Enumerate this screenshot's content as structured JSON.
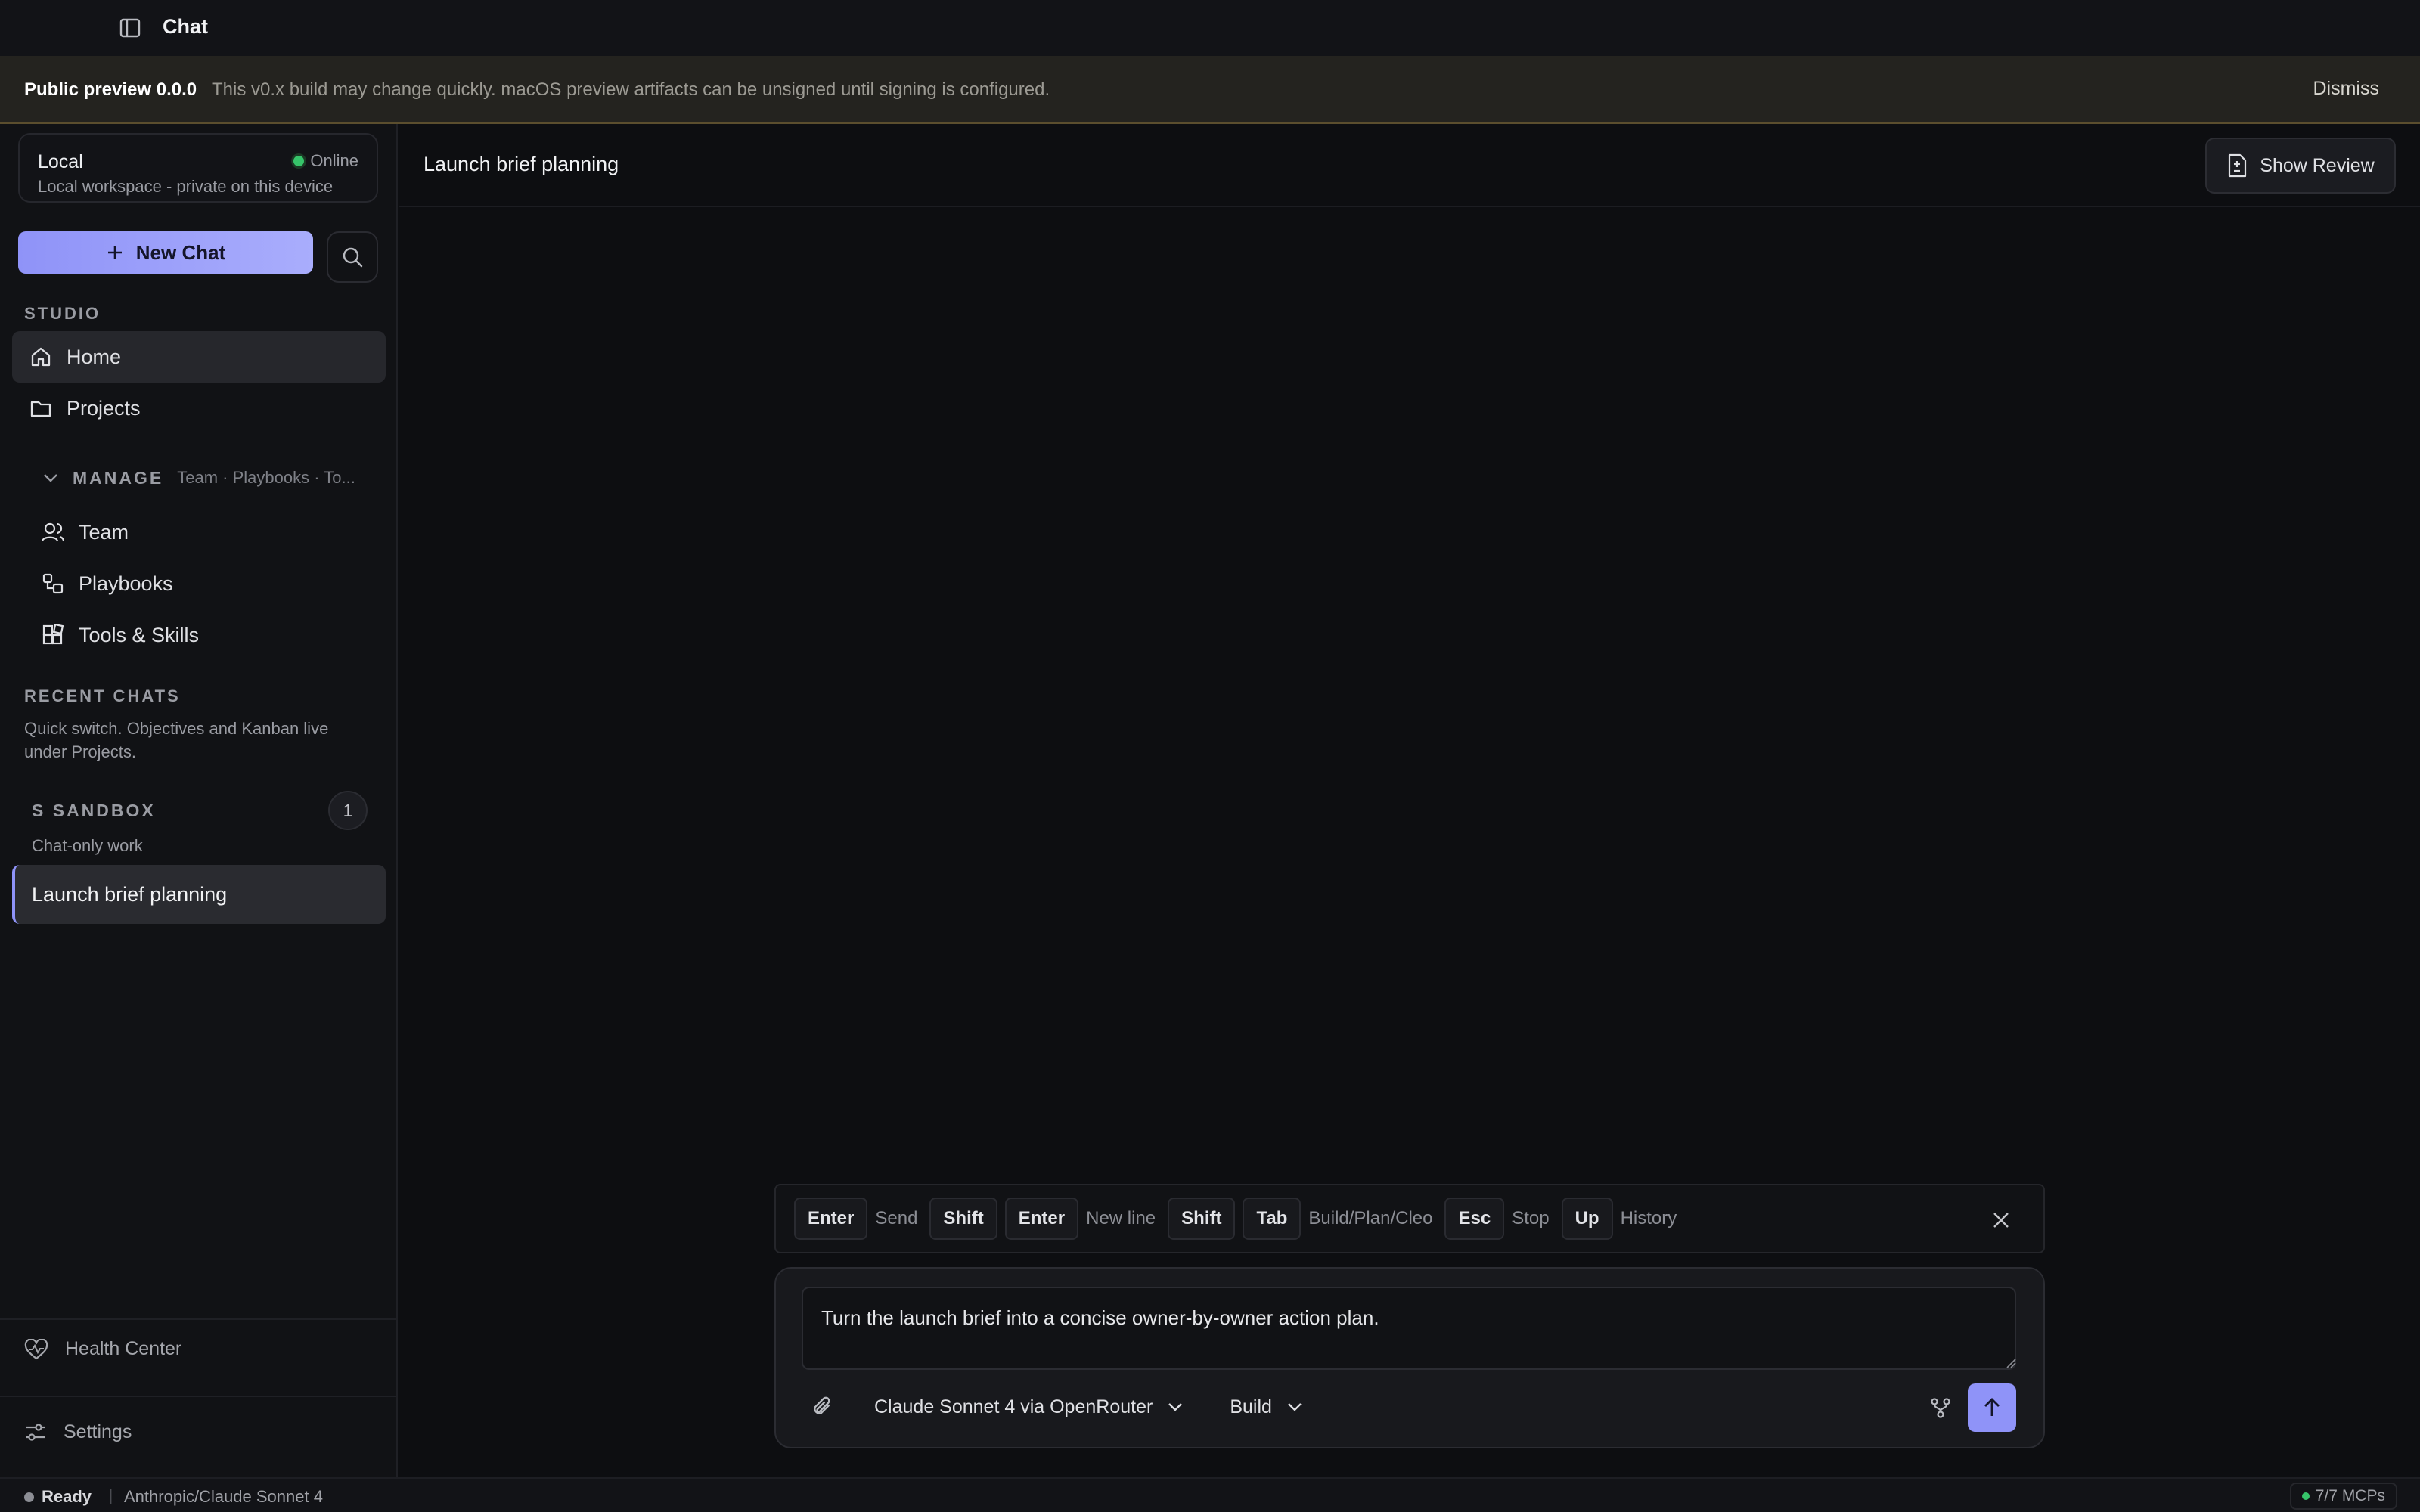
{
  "app": {
    "title": "Chat"
  },
  "banner": {
    "tag": "Public preview 0.0.0",
    "message": "This v0.x build may change quickly. macOS preview artifacts can be unsigned until signing is configured.",
    "dismiss": "Dismiss"
  },
  "sidebar": {
    "workspace": {
      "name": "Local",
      "status": "Online",
      "description": "Local workspace - private on this device"
    },
    "new_chat": "New Chat",
    "studio_label": "STUDIO",
    "studio_items": [
      {
        "label": "Home",
        "icon": "home-icon",
        "active": true
      },
      {
        "label": "Projects",
        "icon": "folder-icon",
        "active": false
      }
    ],
    "manage": {
      "label": "MANAGE",
      "summary": "Team · Playbooks · To..."
    },
    "manage_items": [
      {
        "label": "Team",
        "icon": "users-icon"
      },
      {
        "label": "Playbooks",
        "icon": "playbook-icon"
      },
      {
        "label": "Tools & Skills",
        "icon": "grid-plus-icon"
      }
    ],
    "recent_label": "RECENT CHATS",
    "recent_description": "Quick switch. Objectives and Kanban live under Projects.",
    "sandbox": {
      "label": "S SANDBOX",
      "count": "1",
      "description": "Chat-only work"
    },
    "chats": [
      {
        "label": "Launch brief planning",
        "active": true
      }
    ],
    "footer": {
      "health": "Health Center",
      "settings": "Settings"
    }
  },
  "main": {
    "conversation_title": "Launch brief planning",
    "show_review": "Show Review",
    "shortcuts": [
      {
        "keys": [
          "Enter"
        ],
        "desc": "Send"
      },
      {
        "keys": [
          "Shift",
          "Enter"
        ],
        "desc": "New line"
      },
      {
        "keys": [
          "Shift",
          "Tab"
        ],
        "desc": "Build/Plan/Cleo"
      },
      {
        "keys": [
          "Esc"
        ],
        "desc": "Stop"
      },
      {
        "keys": [
          "Up"
        ],
        "desc": "History"
      }
    ],
    "composer": {
      "value": "Turn the launch brief into a concise owner-by-owner action plan.",
      "model": "Claude Sonnet 4 via OpenRouter",
      "mode": "Build"
    }
  },
  "status_bar": {
    "state": "Ready",
    "model": "Anthropic/Claude Sonnet 4",
    "mcps": "7/7 MCPs"
  },
  "colors": {
    "accent": "#8f93f8",
    "online": "#36c46a",
    "banner_bg": "#24231f"
  }
}
